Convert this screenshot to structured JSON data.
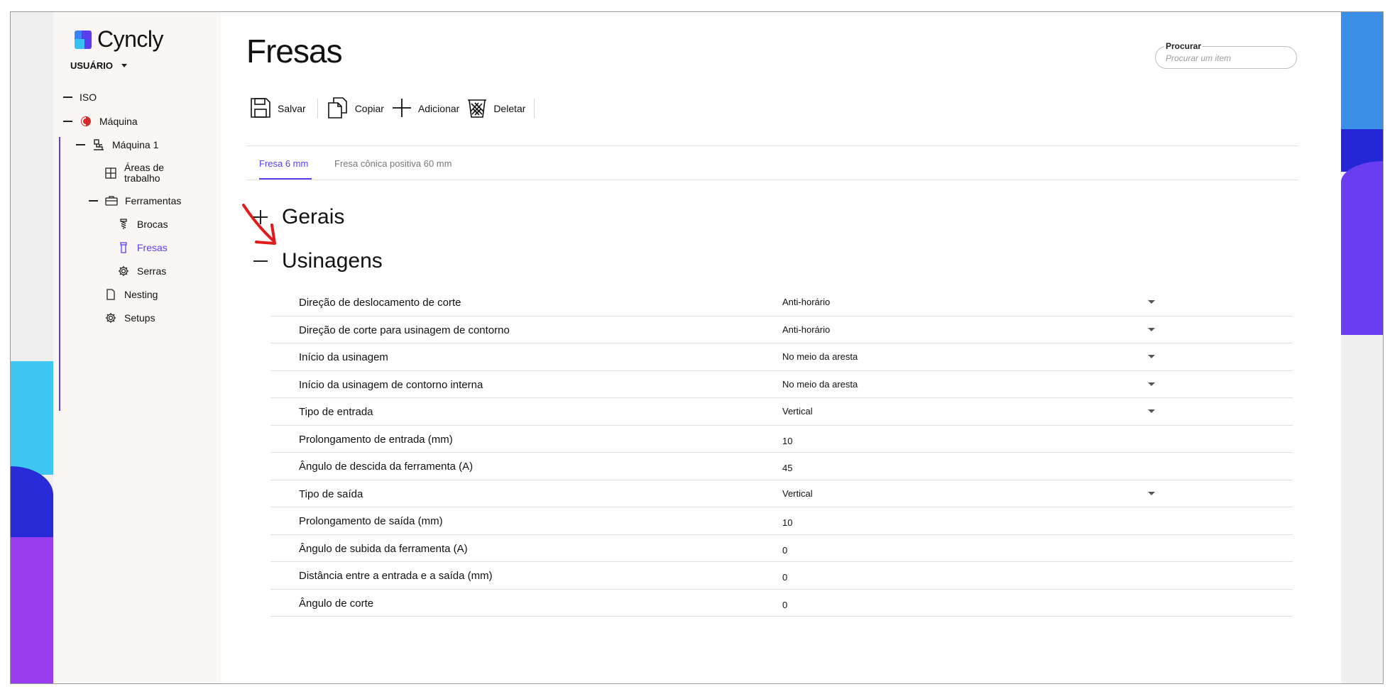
{
  "app": {
    "brand": "Cyncly",
    "user_label": "USUÁRIO"
  },
  "sidebar": {
    "items": [
      {
        "label": "ISO",
        "icon": "dash"
      },
      {
        "label": "Máquina",
        "icon": "machine-logo-icon"
      },
      {
        "label": "Máquina 1",
        "icon": "machine-icon"
      },
      {
        "label": "Áreas de trabalho",
        "icon": "grid-icon"
      },
      {
        "label": "Ferramentas",
        "icon": "toolbox-icon"
      },
      {
        "label": "Brocas",
        "icon": "drill-bit-icon"
      },
      {
        "label": "Fresas",
        "icon": "mill-icon",
        "active": true
      },
      {
        "label": "Serras",
        "icon": "saw-gear-icon"
      },
      {
        "label": "Nesting",
        "icon": "document-icon"
      },
      {
        "label": "Setups",
        "icon": "gear-icon"
      }
    ]
  },
  "main": {
    "title": "Fresas",
    "search": {
      "label": "Procurar",
      "placeholder": "Procurar um item"
    },
    "toolbar": {
      "save": "Salvar",
      "copy": "Copiar",
      "add": "Adicionar",
      "delete": "Deletar"
    },
    "tabs": [
      {
        "label": "Fresa 6 mm",
        "active": true
      },
      {
        "label": "Fresa cônica positiva 60 mm",
        "active": false
      }
    ],
    "sections": {
      "general": "Gerais",
      "machining": "Usinagens"
    },
    "rows": [
      {
        "label": "Direção de deslocamento de corte",
        "value": "Anti-horário",
        "dropdown": true
      },
      {
        "label": "Direção de corte para usinagem de contorno",
        "value": "Anti-horário",
        "dropdown": true
      },
      {
        "label": "Início da usinagem",
        "value": "No meio da aresta",
        "dropdown": true
      },
      {
        "label": "Início da usinagem de contorno interna",
        "value": "No meio da aresta",
        "dropdown": true
      },
      {
        "label": "Tipo de entrada",
        "value": "Vertical",
        "dropdown": true
      },
      {
        "label": "Prolongamento de entrada (mm)",
        "value": "10",
        "dropdown": false
      },
      {
        "label": "Ângulo de descida da ferramenta (A)",
        "value": "45",
        "dropdown": false
      },
      {
        "label": "Tipo de saída",
        "value": "Vertical",
        "dropdown": true
      },
      {
        "label": "Prolongamento de saída (mm)",
        "value": "10",
        "dropdown": false
      },
      {
        "label": "Ângulo de subida da ferramenta (A)",
        "value": "0",
        "dropdown": false
      },
      {
        "label": "Distância entre a entrada e a saída (mm)",
        "value": "0",
        "dropdown": false
      },
      {
        "label": "Ângulo de corte",
        "value": "0",
        "dropdown": false
      }
    ]
  },
  "colors": {
    "accent": "#5b3df0",
    "annotation_arrow": "#e01b1b"
  }
}
